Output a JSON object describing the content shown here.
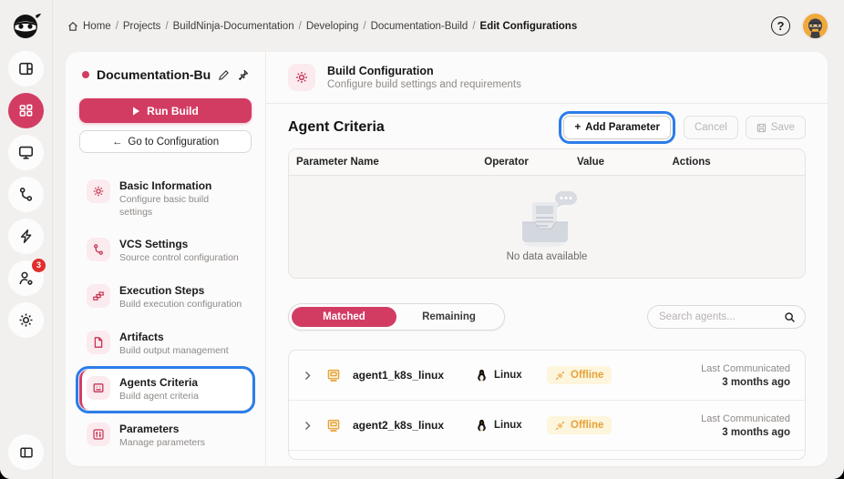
{
  "colors": {
    "accent": "#d23c63",
    "annotation_blue": "#2b7de9",
    "offline_orange": "#e5a23a",
    "page_bg": "#f2f0ef",
    "card_bg": "#fcfbfb"
  },
  "breadcrumb": {
    "separator": "/",
    "items": [
      "Home",
      "Projects",
      "BuildNinja-Documentation",
      "Developing",
      "Documentation-Build"
    ],
    "current": "Edit Configurations"
  },
  "topbar": {
    "help_label": "?"
  },
  "rail": {
    "badge_count": "3",
    "icons": [
      "ninja-logo",
      "layout",
      "apps-grid",
      "monitor",
      "git-branch",
      "lightning",
      "user-gear",
      "settings-gear",
      "panel-toggle"
    ]
  },
  "sidebar": {
    "title": "Documentation-Bu...",
    "run_build_label": "Run Build",
    "goto_arrow": "←",
    "goto_label": "Go to Configuration",
    "nav": [
      {
        "label": "Basic Information",
        "desc": "Configure basic build settings",
        "icon": "gear-icon"
      },
      {
        "label": "VCS Settings",
        "desc": "Source control configuration",
        "icon": "branch-icon"
      },
      {
        "label": "Execution Steps",
        "desc": "Build execution configuration",
        "icon": "steps-icon"
      },
      {
        "label": "Artifacts",
        "desc": "Build output management",
        "icon": "file-icon"
      },
      {
        "label": "Agents Criteria",
        "desc": "Build agent criteria",
        "icon": "agent-icon",
        "active": true
      },
      {
        "label": "Parameters",
        "desc": "Manage parameters",
        "icon": "params-icon"
      }
    ]
  },
  "main": {
    "header": {
      "title": "Build Configuration",
      "subtitle": "Configure build settings and requirements"
    },
    "section_title": "Agent Criteria",
    "actions": {
      "add_plus": "+",
      "add_parameter": "Add Parameter",
      "cancel": "Cancel",
      "save": "Save"
    },
    "table": {
      "columns": [
        "Parameter Name",
        "Operator",
        "Value",
        "Actions"
      ],
      "empty_text": "No data available",
      "rows": []
    },
    "tabs": [
      {
        "label": "Matched",
        "active": true
      },
      {
        "label": "Remaining",
        "active": false
      }
    ],
    "search_placeholder": "Search agents...",
    "agents": [
      {
        "name": "agent1_k8s_linux",
        "os": "Linux",
        "status": "Offline",
        "last_label": "Last Communicated",
        "last_value": "3 months ago"
      },
      {
        "name": "agent2_k8s_linux",
        "os": "Linux",
        "status": "Offline",
        "last_label": "Last Communicated",
        "last_value": "3 months ago"
      }
    ]
  }
}
